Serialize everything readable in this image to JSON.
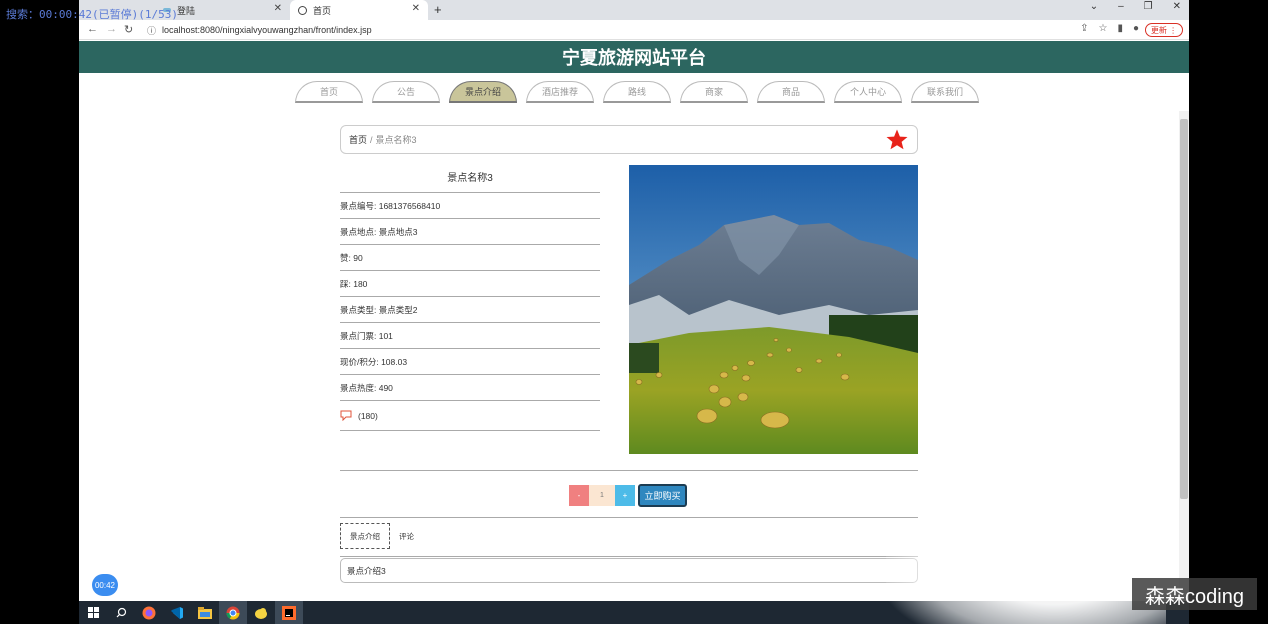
{
  "overlay": {
    "recording_text": "搜索：00:00:42(已暂停)(1/53)"
  },
  "browser": {
    "tabs": [
      {
        "label": "登陆"
      },
      {
        "label": "首页"
      }
    ],
    "url": "localhost:8080/ningxialvyouwangzhan/front/index.jsp",
    "update_label": "更新"
  },
  "site": {
    "title": "宁夏旅游网站平台",
    "nav": [
      {
        "label": "首页",
        "active": false
      },
      {
        "label": "公告",
        "active": false
      },
      {
        "label": "景点介绍",
        "active": true
      },
      {
        "label": "酒店推荐",
        "active": false
      },
      {
        "label": "路线",
        "active": false
      },
      {
        "label": "商家",
        "active": false
      },
      {
        "label": "商品",
        "active": false
      },
      {
        "label": "个人中心",
        "active": false
      },
      {
        "label": "联系我们",
        "active": false
      }
    ]
  },
  "breadcrumb": {
    "home": "首页",
    "separator": "/",
    "current": "景点名称3"
  },
  "detail": {
    "title": "景点名称3",
    "rows": [
      "景点编号: 1681376568410",
      "景点地点: 景点地点3",
      "赞: 90",
      "踩: 180",
      "景点类型: 景点类型2",
      "景点门票: 101",
      "现价/积分: 108.03",
      "景点热度: 490"
    ],
    "comment_count": "(180)"
  },
  "purchase": {
    "minus": "-",
    "quantity": "1",
    "plus": "+",
    "buy_label": "立即购买"
  },
  "content_tabs": [
    {
      "label": "景点介绍",
      "active": true
    },
    {
      "label": "评论",
      "active": false
    }
  ],
  "intro_text": "景点介绍3",
  "timer": "00:42",
  "watermark": "森森coding",
  "colors": {
    "header": "#2c6660",
    "active_nav": "#c9c59a",
    "star": "#e8231a",
    "buy": "#2f87bf"
  }
}
